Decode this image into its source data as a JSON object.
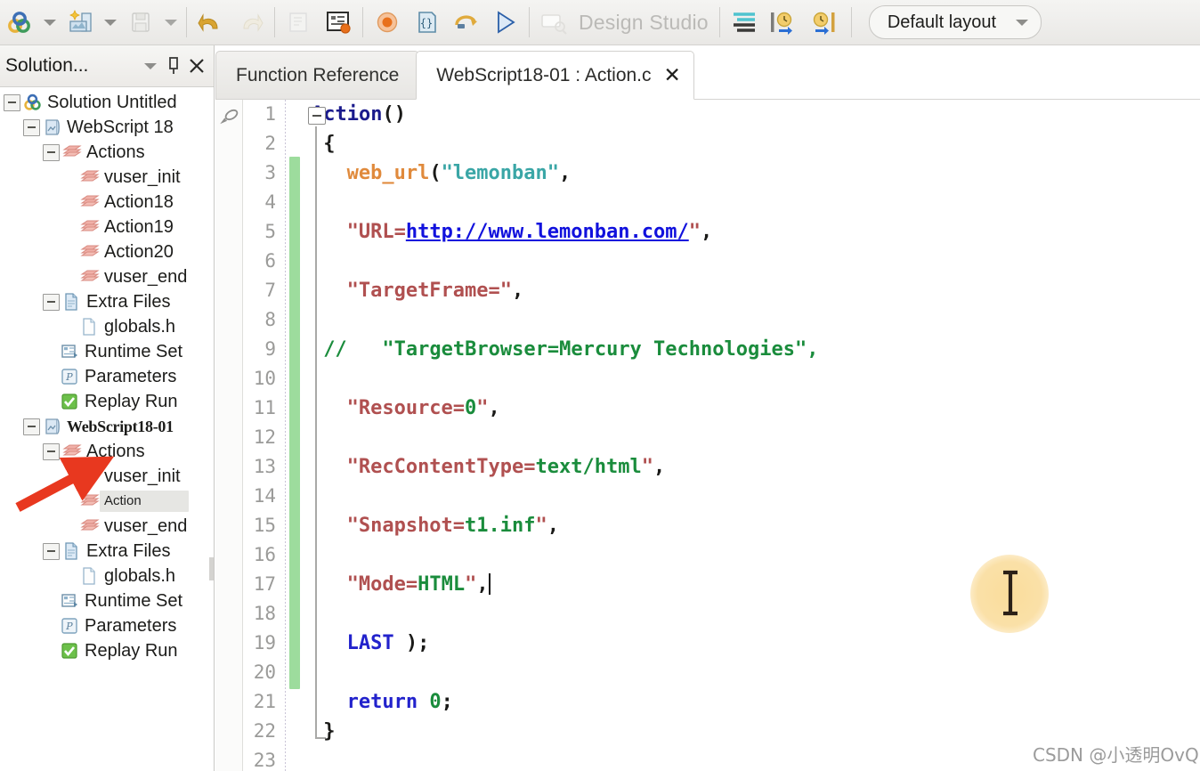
{
  "toolbar": {
    "buttons": [
      {
        "name": "new-solution-icon",
        "label": "New Solution"
      },
      {
        "name": "new-solution-dropdown",
        "label": ""
      },
      {
        "name": "create-script-icon",
        "label": "Create Script"
      },
      {
        "name": "create-script-dropdown",
        "label": ""
      },
      {
        "name": "save-icon",
        "label": "Save"
      },
      {
        "name": "save-dropdown",
        "label": ""
      },
      {
        "name": "undo-icon",
        "label": "Undo"
      },
      {
        "name": "redo-icon",
        "label": "Redo"
      },
      {
        "name": "compile-icon",
        "label": "Compile"
      },
      {
        "name": "runtime-settings-icon",
        "label": "Runtime Settings"
      },
      {
        "name": "record-icon",
        "label": "Record"
      },
      {
        "name": "step-icon",
        "label": "Step"
      },
      {
        "name": "replay-icon",
        "label": "Replay"
      },
      {
        "name": "run-icon",
        "label": "Run"
      },
      {
        "name": "design-studio-icon",
        "label": "Design Studio"
      },
      {
        "name": "script-view-icon",
        "label": "Script View"
      },
      {
        "name": "insert-start-transaction-icon",
        "label": "Start Transaction"
      },
      {
        "name": "insert-end-transaction-icon",
        "label": "End Transaction"
      }
    ],
    "design_studio_label": "Design Studio",
    "layout_label": "Default layout"
  },
  "left_panel": {
    "title": "Solution...",
    "header_icons": [
      "chevron-down-icon",
      "pin-icon",
      "close-icon"
    ],
    "tree": [
      {
        "level": 0,
        "twisty": true,
        "icon": "solution-icon",
        "label": "Solution Untitled",
        "style": "normal",
        "selected": false
      },
      {
        "level": 1,
        "twisty": true,
        "icon": "script-icon",
        "label": "WebScript 18",
        "style": "normal",
        "selected": false
      },
      {
        "level": 2,
        "twisty": true,
        "icon": "actions-icon",
        "label": "Actions",
        "style": "normal",
        "selected": false
      },
      {
        "level": 3,
        "twisty": false,
        "icon": "action-icon",
        "label": "vuser_init",
        "style": "normal",
        "selected": false
      },
      {
        "level": 3,
        "twisty": false,
        "icon": "action-icon",
        "label": "Action18",
        "style": "normal",
        "selected": false
      },
      {
        "level": 3,
        "twisty": false,
        "icon": "action-icon",
        "label": "Action19",
        "style": "normal",
        "selected": false
      },
      {
        "level": 3,
        "twisty": false,
        "icon": "action-icon",
        "label": "Action20",
        "style": "normal",
        "selected": false
      },
      {
        "level": 3,
        "twisty": false,
        "icon": "action-icon",
        "label": "vuser_end",
        "style": "normal",
        "selected": false
      },
      {
        "level": 2,
        "twisty": true,
        "icon": "extra-files-icon",
        "label": "Extra Files",
        "style": "normal",
        "selected": false
      },
      {
        "level": 3,
        "twisty": false,
        "icon": "file-icon",
        "label": "globals.h",
        "style": "normal",
        "selected": false
      },
      {
        "level": 2,
        "twisty": false,
        "icon": "runtime-icon",
        "label": "Runtime Set",
        "style": "normal",
        "selected": false
      },
      {
        "level": 2,
        "twisty": false,
        "icon": "parameters-icon",
        "label": "Parameters",
        "style": "normal",
        "selected": false
      },
      {
        "level": 2,
        "twisty": false,
        "icon": "replay-run-icon",
        "label": "Replay Run",
        "style": "normal",
        "selected": false
      },
      {
        "level": 1,
        "twisty": true,
        "icon": "script-icon",
        "label": "WebScript18-01",
        "style": "bold-serif",
        "selected": false
      },
      {
        "level": 2,
        "twisty": true,
        "icon": "actions-icon",
        "label": "Actions",
        "style": "normal",
        "selected": false
      },
      {
        "level": 3,
        "twisty": false,
        "icon": "action-icon",
        "label": "vuser_init",
        "style": "normal",
        "selected": false
      },
      {
        "level": 3,
        "twisty": false,
        "icon": "action-icon",
        "label": "Action",
        "style": "small-sel",
        "selected": true
      },
      {
        "level": 3,
        "twisty": false,
        "icon": "action-icon",
        "label": "vuser_end",
        "style": "normal",
        "selected": false
      },
      {
        "level": 2,
        "twisty": true,
        "icon": "extra-files-icon",
        "label": "Extra Files",
        "style": "normal",
        "selected": false
      },
      {
        "level": 3,
        "twisty": false,
        "icon": "file-icon",
        "label": "globals.h",
        "style": "normal",
        "selected": false
      },
      {
        "level": 2,
        "twisty": false,
        "icon": "runtime-icon",
        "label": "Runtime Set",
        "style": "normal",
        "selected": false
      },
      {
        "level": 2,
        "twisty": false,
        "icon": "parameters-icon",
        "label": "Parameters",
        "style": "normal",
        "selected": false
      },
      {
        "level": 2,
        "twisty": false,
        "icon": "replay-run-icon",
        "label": "Replay Run",
        "style": "normal",
        "selected": false
      }
    ]
  },
  "editor": {
    "tabs": [
      {
        "label": "Function Reference",
        "active": false,
        "closable": false
      },
      {
        "label": "WebScript18-01 : Action.c",
        "active": true,
        "closable": true,
        "close_glyph": "✕"
      }
    ],
    "first_line_number": 1,
    "total_visible_lines": 23,
    "code_lines": [
      {
        "n": 1,
        "tokens": [
          {
            "t": "Action",
            "c": "t-fn"
          },
          {
            "t": "()",
            "c": "t-plain"
          }
        ]
      },
      {
        "n": 2,
        "tokens": [
          {
            "t": "{",
            "c": "t-plain"
          }
        ],
        "indent": 1
      },
      {
        "n": 3,
        "tokens": [
          {
            "t": "web_url",
            "c": "t-call"
          },
          {
            "t": "(",
            "c": "t-punc"
          },
          {
            "t": "\"lemonban\"",
            "c": "t-str"
          },
          {
            "t": ",",
            "c": "t-punc"
          }
        ],
        "indent": 3
      },
      {
        "n": 4,
        "tokens": []
      },
      {
        "n": 5,
        "tokens": [
          {
            "t": "\"URL=",
            "c": "t-attr"
          },
          {
            "t": "http://www.lemonban.com/",
            "c": "t-link"
          },
          {
            "t": "\"",
            "c": "t-attr"
          },
          {
            "t": ",",
            "c": "t-punc"
          }
        ],
        "indent": 3
      },
      {
        "n": 6,
        "tokens": []
      },
      {
        "n": 7,
        "tokens": [
          {
            "t": "\"TargetFrame=\"",
            "c": "t-attr"
          },
          {
            "t": ",",
            "c": "t-punc"
          }
        ],
        "indent": 3
      },
      {
        "n": 8,
        "tokens": []
      },
      {
        "n": 9,
        "tokens": [
          {
            "t": "//   \"TargetBrowser=Mercury Technologies\",",
            "c": "t-comment"
          }
        ],
        "indent": 1
      },
      {
        "n": 10,
        "tokens": []
      },
      {
        "n": 11,
        "tokens": [
          {
            "t": "\"Resource=",
            "c": "t-attr"
          },
          {
            "t": "0",
            "c": "t-val"
          },
          {
            "t": "\"",
            "c": "t-attr"
          },
          {
            "t": ",",
            "c": "t-punc"
          }
        ],
        "indent": 3
      },
      {
        "n": 12,
        "tokens": []
      },
      {
        "n": 13,
        "tokens": [
          {
            "t": "\"RecContentType=",
            "c": "t-attr"
          },
          {
            "t": "text/html",
            "c": "t-val"
          },
          {
            "t": "\"",
            "c": "t-attr"
          },
          {
            "t": ",",
            "c": "t-punc"
          }
        ],
        "indent": 3
      },
      {
        "n": 14,
        "tokens": []
      },
      {
        "n": 15,
        "tokens": [
          {
            "t": "\"Snapshot=",
            "c": "t-attr"
          },
          {
            "t": "t1.inf",
            "c": "t-val"
          },
          {
            "t": "\"",
            "c": "t-attr"
          },
          {
            "t": ",",
            "c": "t-punc"
          }
        ],
        "indent": 3
      },
      {
        "n": 16,
        "tokens": []
      },
      {
        "n": 17,
        "tokens": [
          {
            "t": "\"Mode=",
            "c": "t-attr"
          },
          {
            "t": "HTML",
            "c": "t-val"
          },
          {
            "t": "\"",
            "c": "t-attr"
          },
          {
            "t": ",",
            "c": "t-punc"
          },
          {
            "t": "",
            "c": "caret"
          }
        ],
        "indent": 3
      },
      {
        "n": 18,
        "tokens": []
      },
      {
        "n": 19,
        "tokens": [
          {
            "t": "LAST",
            "c": "t-kw"
          },
          {
            "t": " );",
            "c": "t-punc"
          }
        ],
        "indent": 3
      },
      {
        "n": 20,
        "tokens": []
      },
      {
        "n": 21,
        "tokens": [
          {
            "t": "return",
            "c": "t-kw"
          },
          {
            "t": " ",
            "c": "t-punc"
          },
          {
            "t": "0",
            "c": "t-num"
          },
          {
            "t": ";",
            "c": "t-punc"
          }
        ],
        "indent": 3
      },
      {
        "n": 22,
        "tokens": [
          {
            "t": "}",
            "c": "t-plain"
          }
        ],
        "indent": 1
      },
      {
        "n": 23,
        "tokens": []
      }
    ]
  },
  "overlay": {
    "watermark": "CSDN @小透明OvQ",
    "cursor_icon": "i-beam-cursor",
    "annotation_arrow": "red-arrow-pointing-to-action"
  },
  "colors": {
    "changebar_green": "#9ddc9d",
    "cursor_halo": "#fadc9a",
    "annotation_red": "#e8381f",
    "link_blue": "#1111dd",
    "keyword_blue": "#2222cc",
    "string_teal": "#3aa6a6",
    "attr_red": "#b05050",
    "value_green": "#1a8c3c",
    "call_orange": "#e08a3c"
  }
}
